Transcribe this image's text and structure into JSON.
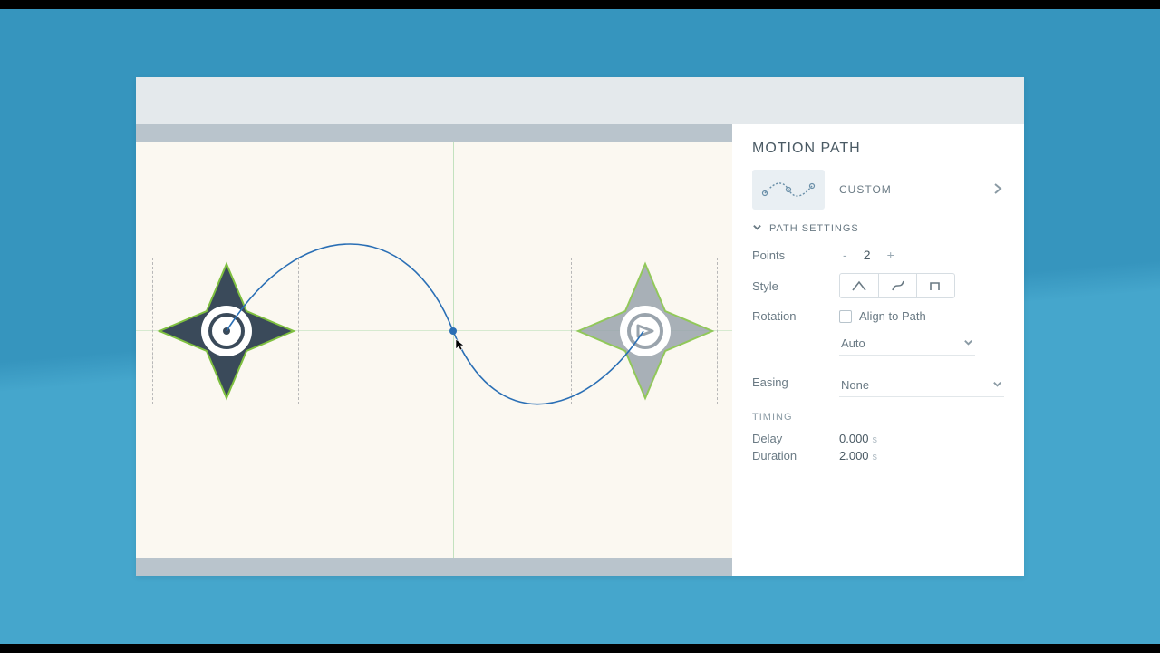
{
  "panel": {
    "title": "MOTION PATH",
    "path_type_label": "CUSTOM",
    "settings_header": "PATH SETTINGS",
    "points": {
      "label": "Points",
      "value": "2"
    },
    "style": {
      "label": "Style"
    },
    "rotation": {
      "label": "Rotation",
      "checkbox_label": "Align to Path",
      "direction_value": "Auto"
    },
    "easing": {
      "label": "Easing",
      "value": "None"
    },
    "timing_header": "TIMING",
    "delay": {
      "label": "Delay",
      "value": "0.000",
      "unit": "s"
    },
    "duration": {
      "label": "Duration",
      "value": "2.000",
      "unit": "s"
    }
  }
}
